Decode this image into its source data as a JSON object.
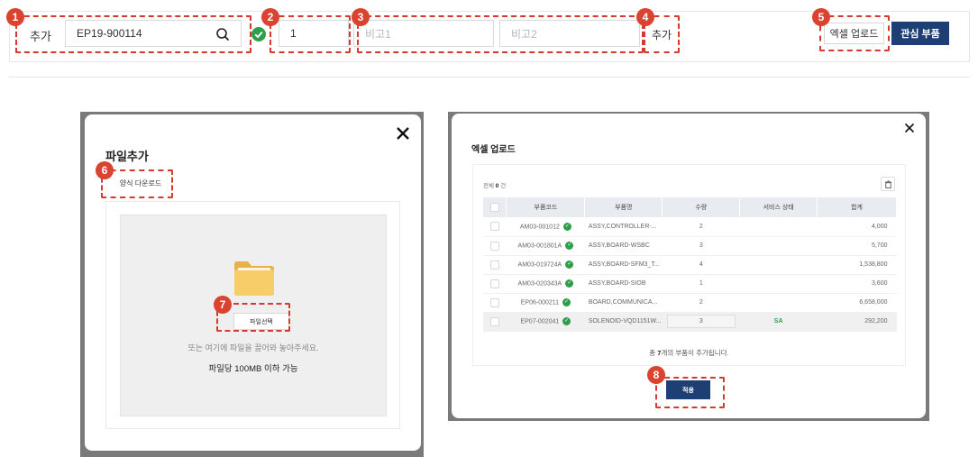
{
  "toolbar": {
    "add_label": "추가",
    "search_value": "EP19-900114",
    "qty_value": "1",
    "note1_placeholder": "비고1",
    "note2_placeholder": "비고2",
    "add_button": "추가",
    "excel_upload_button": "엑셀 업로드",
    "favorite_parts_button": "관심 부품"
  },
  "callouts": [
    "1",
    "2",
    "3",
    "4",
    "5",
    "6",
    "7",
    "8"
  ],
  "file_modal": {
    "title": "파일추가",
    "template_download_button": "양식 다운로드",
    "select_file_button": "파일선택",
    "drop_hint": "또는 여기에 파일을 끌어와 놓아주세요.",
    "size_limit": "파일당 100MB 이하 가능"
  },
  "excel_modal": {
    "title": "엑셀 업로드",
    "total_prefix": "전체",
    "total_count": "0",
    "total_suffix": "건",
    "columns": [
      "부품코드",
      "부품명",
      "수량",
      "서비스 상태",
      "합계"
    ],
    "rows": [
      {
        "code": "AM03-001012",
        "name": "ASSY,CONTROLLER-...",
        "qty": "2",
        "status": "",
        "total": "4,000"
      },
      {
        "code": "AM03-001801A",
        "name": "ASSY,BOARD-WSBC",
        "qty": "3",
        "status": "",
        "total": "5,700"
      },
      {
        "code": "AM03-019724A",
        "name": "ASSY,BOARD-SFM3_T...",
        "qty": "4",
        "status": "",
        "total": "1,538,800"
      },
      {
        "code": "AM03-020343A",
        "name": "ASSY,BOARD-SIOB",
        "qty": "1",
        "status": "",
        "total": "3,600"
      },
      {
        "code": "EP06-000211",
        "name": "BOARD,COMMUNICA...",
        "qty": "2",
        "status": "",
        "total": "6,658,000"
      },
      {
        "code": "EP07-002041",
        "name": "SOLENOID-VQD1151W...",
        "qty": "3",
        "status": "SA",
        "total": "292,200"
      }
    ],
    "summary_prefix": "총 ",
    "summary_count": "7",
    "summary_suffix": "개의 부품이 추가됩니다.",
    "apply_button": "적용"
  },
  "colors": {
    "accent": "#1d3f73",
    "callout": "#d9432f",
    "success": "#2e9e4a"
  }
}
